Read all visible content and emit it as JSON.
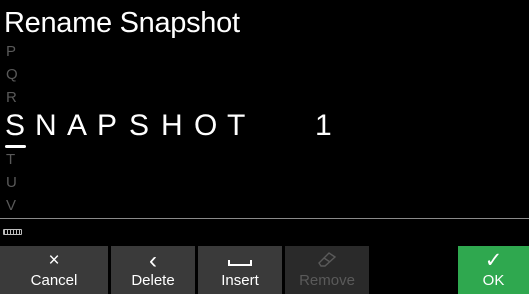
{
  "title": "Rename Snapshot",
  "char_picker": {
    "above": [
      "P",
      "Q",
      "R"
    ],
    "selected": "S",
    "below": [
      "T",
      "U",
      "V"
    ]
  },
  "name_chars": [
    "N",
    "A",
    "P",
    "S",
    "H",
    "O",
    "T",
    "1"
  ],
  "buttons": {
    "cancel": {
      "icon": "×",
      "label": "Cancel"
    },
    "delete": {
      "icon": "‹",
      "label": "Delete"
    },
    "insert": {
      "label": "Insert"
    },
    "remove": {
      "label": "Remove"
    },
    "ok": {
      "icon": "✓",
      "label": "OK"
    }
  },
  "colors": {
    "background": "#000000",
    "button_bg": "#3a3a3a",
    "ok_bg": "#2fa84f",
    "dim_text": "#595959"
  },
  "icons": {
    "cancel": "close-icon",
    "delete": "chevron-left-icon",
    "insert": "space-bar-icon",
    "remove": "eraser-icon",
    "ok": "checkmark-icon",
    "keyboard": "keyboard-icon"
  }
}
